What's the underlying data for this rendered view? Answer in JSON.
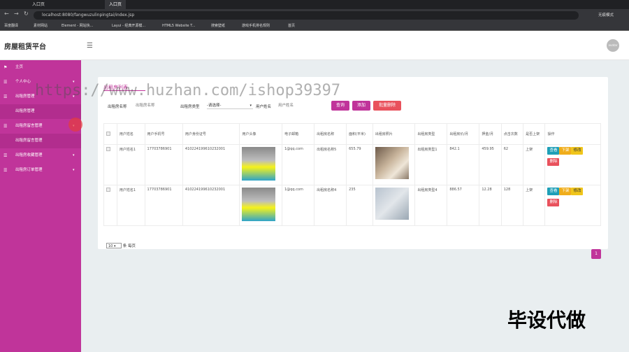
{
  "browser": {
    "tabs": [
      "入口页",
      "入口页"
    ],
    "address": "localhost:8080/fangwuzulinpingtai/index.jsp",
    "profile": "无痕模式",
    "bookmarks": [
      "百度翻译",
      "素材网站",
      "Element - 网站快...",
      "Layui - 经典开源模...",
      "HTML5 Website T...",
      "搜索壁纸",
      "游戏手机排名规则",
      "首页"
    ]
  },
  "app": {
    "title": "房屋租赁平台",
    "avatar_text": "avatar"
  },
  "sidebar": {
    "items": [
      {
        "label": "主页",
        "icon": "flag-icon",
        "chev": ""
      },
      {
        "label": "个人中心",
        "icon": "menu-icon",
        "chev": "▾"
      },
      {
        "label": "出租房管理",
        "icon": "menu-icon",
        "chev": "▾"
      },
      {
        "label": "出租房管理",
        "icon": "",
        "chev": ""
      },
      {
        "label": "出租房留言管理",
        "icon": "menu-icon",
        "chev": "▾"
      },
      {
        "label": "出租房留言管理",
        "icon": "",
        "chev": ""
      },
      {
        "label": "出租房收藏管理",
        "icon": "menu-icon",
        "chev": "▾"
      },
      {
        "label": "出租房订单管理",
        "icon": "menu-icon",
        "chev": "▾"
      }
    ]
  },
  "page": {
    "title": "出租房列表",
    "search": {
      "name_label": "出租房名称",
      "name_placeholder": "出租房名称",
      "type_label": "出租房类型",
      "type_value": "-请选择-",
      "user_label": "用户姓名",
      "user_placeholder": "用户姓名"
    },
    "buttons": {
      "query": "查询",
      "add": "添加",
      "batch_delete": "批量删除"
    },
    "table": {
      "headers": [
        "用户姓名",
        "用户手机号",
        "用户身份证号",
        "用户头像",
        "电子邮箱",
        "出租房名称",
        "面积(平米)",
        "出租房照片",
        "出租房类型",
        "出租房价/月",
        "押金/月",
        "点击次数",
        "是否上架",
        "操作"
      ],
      "rows": [
        [
          "用户姓名1",
          "17703786901",
          "410224199610232001",
          "",
          "1@qq.com",
          "出租房名称5",
          "655.79",
          "",
          "出租房类型1",
          "842.1",
          "459.95",
          "62",
          "上架"
        ],
        [
          "用户姓名1",
          "17703786901",
          "410224199610232001",
          "",
          "1@qq.com",
          "出租房名称4",
          "235",
          "",
          "出租房类型4",
          "886.57",
          "12.28",
          "128",
          "上架"
        ]
      ],
      "actions": {
        "view": "查看",
        "down": "下架",
        "edit": "修改",
        "delete": "删除"
      }
    },
    "pager": {
      "size": "10",
      "suffix": "条 每页",
      "current": "1"
    }
  },
  "overlay": {
    "watermark": "https://www.huzhan.com/ishop39397",
    "corner_text": "毕设代做"
  },
  "colors": {
    "accent": "#c0349a",
    "danger": "#e9515c",
    "info": "#1e9fb7",
    "warning": "#f0ad1b"
  }
}
